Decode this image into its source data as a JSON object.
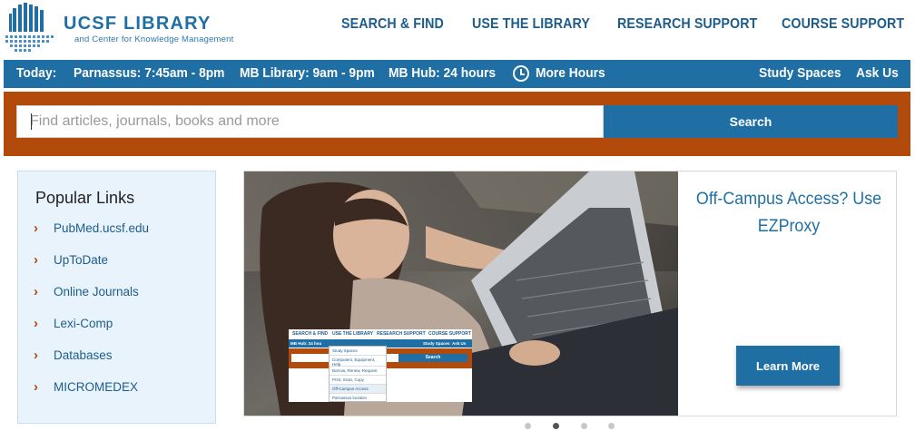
{
  "logo": {
    "title": "UCSF LIBRARY",
    "subtitle": "and Center for Knowledge Management"
  },
  "main_nav": [
    {
      "label": "SEARCH & FIND"
    },
    {
      "label": "USE THE LIBRARY"
    },
    {
      "label": "RESEARCH SUPPORT"
    },
    {
      "label": "COURSE SUPPORT"
    }
  ],
  "hours_bar": {
    "today_label": "Today:",
    "parnassus": "Parnassus: 7:45am - 8pm",
    "mb_library": "MB Library: 9am - 9pm",
    "mb_hub": "MB Hub: 24 hours",
    "more_hours": "More Hours",
    "study_spaces": "Study Spaces",
    "ask_us": "Ask Us",
    "clock_icon": "clock-icon"
  },
  "search": {
    "placeholder": "Find articles, journals, books and more",
    "value": "",
    "button_label": "Search"
  },
  "popular_links": {
    "heading": "Popular Links",
    "items": [
      {
        "label": "PubMed.ucsf.edu"
      },
      {
        "label": "UpToDate"
      },
      {
        "label": "Online Journals"
      },
      {
        "label": "Lexi-Comp"
      },
      {
        "label": "Databases"
      },
      {
        "label": "MICROMEDEX"
      }
    ]
  },
  "carousel": {
    "slide_title": "Off-Campus Access? Use EZProxy",
    "button_label": "Learn More",
    "active_slide": 2,
    "slide_count": 4,
    "inset_screenshot": {
      "nav": [
        "SEARCH & FIND",
        "USE THE LIBRARY",
        "RESEARCH SUPPORT",
        "COURSE SUPPORT"
      ],
      "hours_fragment": "MB Hub: 24 hou",
      "bar_links": [
        "Study Spaces",
        "Ask Us"
      ],
      "search_label": "Search",
      "dropdown_items": [
        "Study Spaces",
        "Computers, Equipment, Help",
        "Borrow, Renew, Request",
        "Print, Scan, Copy",
        "Off-Campus Access",
        "Parnassus location"
      ]
    }
  },
  "colors": {
    "brand_blue": "#1f6fa5",
    "nav_blue": "#1d5d8c",
    "search_orange": "#b24a0c",
    "panel_bg": "#e9f3fb"
  }
}
